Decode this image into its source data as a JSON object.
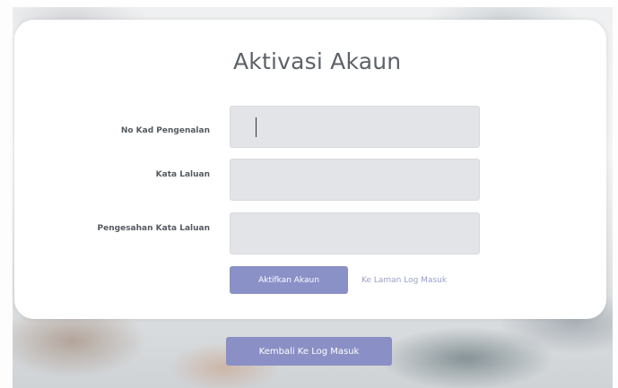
{
  "form": {
    "title": "Aktivasi Akaun",
    "fields": [
      {
        "label": "No Kad Pengenalan",
        "value": ""
      },
      {
        "label": "Kata Laluan",
        "value": ""
      },
      {
        "label": "Pengesahan Kata Laluan",
        "value": ""
      }
    ],
    "submit_label": "Aktifkan Akaun",
    "login_link": "Ke Laman Log Masuk"
  },
  "footer": {
    "back_label": "Kembali Ke Log Masuk"
  },
  "colors": {
    "accent": "#8a91c7",
    "input_bg": "#e2e4e7",
    "title": "#5d6268"
  }
}
